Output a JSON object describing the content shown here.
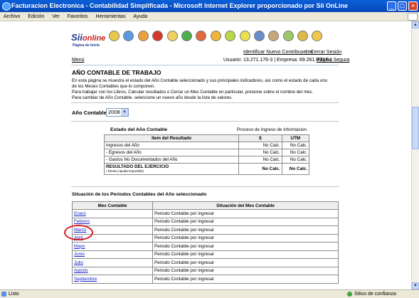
{
  "window": {
    "title": "Facturacion Electronica - Contabilidad Simplificada - Microsoft Internet Explorer proporcionado por Sii OnLine"
  },
  "menubar": [
    "Archivo",
    "Edición",
    "Ver",
    "Favoritos",
    "Herramientas",
    "Ayuda"
  ],
  "status": {
    "left": "Listo",
    "right": "Sitios de confianza"
  },
  "header": {
    "logo_sii": "Sii",
    "logo_online": "online",
    "logo_sub": "Página de Inicio",
    "menu_link": "Menú",
    "link_identify": "Identificar Nuevo Contribuyente",
    "link_close": "Cerrar Sesión",
    "user_line": "Usuario: 13.271.176-3 | Empresa: 69.261.900-5 |",
    "secure_link": "Página Segura"
  },
  "main": {
    "title": "AÑO CONTABLE DE TRABAJO",
    "p1": "En esta página se muestra el estado del Año Contable seleccionado y sus principales indicadores, así como el estado de cada uno",
    "p2": "de los Meses Contables que lo componen.",
    "p3": "Para trabajar con los Libros, Calcular resultados o Cerrar un Mes Contable en particular, presione sobre el nombre del mes.",
    "p4": "Para cambiar de Año Contable, seleccione un nuevo año desde la lista de valores.",
    "year_label": "Año Contable",
    "year_value": "2008"
  },
  "estado": {
    "heading": "Estado del Año Contable",
    "proceso": "Proceso de Ingreso de Informacion",
    "col_item": "Item del Resultado",
    "col_pesos": "$",
    "col_utm": "UTM",
    "rows": [
      {
        "item": "Ingresos del Año",
        "pesos": "No Calc.",
        "utm": "No Calc."
      },
      {
        "item": "- Egresos del Año",
        "pesos": "No Calc.",
        "utm": "No Calc."
      },
      {
        "item": "- Gastos No Documentados del Año",
        "pesos": "No Calc.",
        "utm": "No Calc."
      }
    ],
    "resultado_label": "RESULTADO DEL EJERCICIO",
    "resultado_sub": "( Renta Líquida Imponible)",
    "resultado_pesos": "No Calc.",
    "resultado_utm": "No Calc."
  },
  "periodos": {
    "heading": "Situación de los Periodos Contables del Año seleccionado",
    "col_mes": "Mes Contable",
    "col_situacion": "Situación del Mes Contable",
    "rows": [
      {
        "mes": "Enero",
        "situacion": "Periodo Contable por ingresar"
      },
      {
        "mes": "Febrero",
        "situacion": "Periodo Contable por ingresar"
      },
      {
        "mes": "Marzo",
        "situacion": "Periodo Contable por ingresar"
      },
      {
        "mes": "Abril",
        "situacion": "Periodo Contable por ingresar"
      },
      {
        "mes": "Mayo",
        "situacion": "Periodo Contable por ingresar"
      },
      {
        "mes": "Junio",
        "situacion": "Periodo Contable por ingresar"
      },
      {
        "mes": "Julio",
        "situacion": "Periodo Contable por ingresar"
      },
      {
        "mes": "Agosto",
        "situacion": "Periodo Contable por ingresar"
      },
      {
        "mes": "Septiembre",
        "situacion": "Periodo Contable por ingresar"
      }
    ]
  },
  "colors": {
    "title_bar": "#0a5fd8",
    "link": "#1a22c8",
    "annotation": "#d81c1c",
    "chrome": "#ece9d8"
  },
  "header_icon_names": [
    "person-icon",
    "calendar-icon",
    "coins-icon",
    "alert-icon",
    "document-icon",
    "invoice-icon",
    "chart-icon",
    "folder-icon",
    "book-icon",
    "doc-icon",
    "bank-icon",
    "people-icon",
    "ledger-icon",
    "cert-icon",
    "info-icon"
  ]
}
